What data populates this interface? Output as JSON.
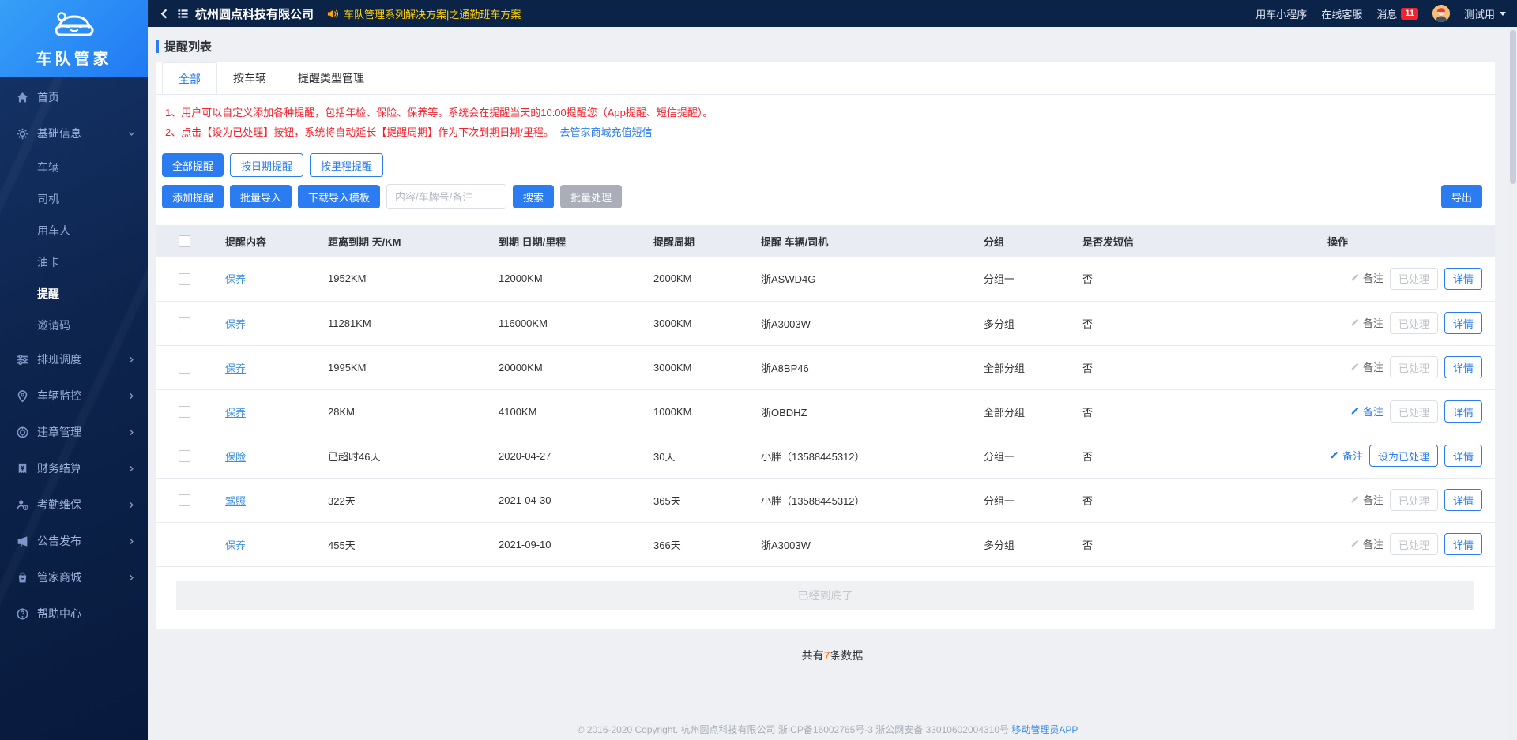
{
  "sidebar": {
    "logo_text": "车队管家",
    "home": {
      "label": "首页"
    },
    "group_basic": {
      "label": "基础信息"
    },
    "submenu": [
      {
        "label": "车辆"
      },
      {
        "label": "司机"
      },
      {
        "label": "用车人"
      },
      {
        "label": "油卡"
      },
      {
        "label": "提醒"
      },
      {
        "label": "邀请码"
      }
    ],
    "groups": [
      {
        "label": "排班调度"
      },
      {
        "label": "车辆监控"
      },
      {
        "label": "违章管理"
      },
      {
        "label": "财务结算"
      },
      {
        "label": "考勤维保"
      },
      {
        "label": "公告发布"
      },
      {
        "label": "管家商城"
      }
    ],
    "help": {
      "label": "帮助中心"
    }
  },
  "topbar": {
    "company": "杭州圆点科技有限公司",
    "announcement": "车队管理系列解决方案|之通勤班车方案",
    "mini_program": "用车小程序",
    "online_service": "在线客服",
    "messages_label": "消息",
    "messages_count": "11",
    "username": "测试用"
  },
  "page": {
    "title": "提醒列表",
    "tabs": [
      {
        "label": "全部"
      },
      {
        "label": "按车辆"
      },
      {
        "label": "提醒类型管理"
      }
    ],
    "notices": [
      "1、用户可以自定义添加各种提醒，包括年检、保险、保养等。系统会在提醒当天的10:00提醒您（App提醒、短信提醒）。",
      "2、点击【设为已处理】按钮，系统将自动延长【提醒周期】作为下次到期日期/里程。"
    ],
    "notice_link": "去管家商城充值短信",
    "filters": [
      {
        "label": "全部提醒"
      },
      {
        "label": "按日期提醒"
      },
      {
        "label": "按里程提醒"
      }
    ],
    "toolbar": {
      "add": "添加提醒",
      "import": "批量导入",
      "template": "下载导入模板",
      "search_placeholder": "内容/车牌号/备注",
      "search": "搜索",
      "batch": "批量处理",
      "export": "导出"
    }
  },
  "table": {
    "headers": [
      "提醒内容",
      "距离到期 天/KM",
      "到期 日期/里程",
      "提醒周期",
      "提醒 车辆/司机",
      "分组",
      "是否发短信",
      "操作"
    ],
    "note_label": "备注",
    "detail_label": "详情",
    "rows": [
      {
        "content": "保养",
        "distance": "1952KM",
        "due": "12000KM",
        "cycle": "2000KM",
        "target": "浙ASWD4G",
        "group": "分组一",
        "sms": "否",
        "note_active": false,
        "process_label": "已处理",
        "process_enabled": false
      },
      {
        "content": "保养",
        "distance": "11281KM",
        "due": "116000KM",
        "cycle": "3000KM",
        "target": "浙A3003W",
        "group": "多分组",
        "sms": "否",
        "note_active": false,
        "process_label": "已处理",
        "process_enabled": false
      },
      {
        "content": "保养",
        "distance": "1995KM",
        "due": "20000KM",
        "cycle": "3000KM",
        "target": "浙A8BP46",
        "group": "全部分组",
        "sms": "否",
        "note_active": false,
        "process_label": "已处理",
        "process_enabled": false
      },
      {
        "content": "保养",
        "distance": "28KM",
        "due": "4100KM",
        "cycle": "1000KM",
        "target": "浙OBDHZ",
        "group": "全部分组",
        "sms": "否",
        "note_active": true,
        "process_label": "已处理",
        "process_enabled": false
      },
      {
        "content": "保险",
        "distance": "已超时46天",
        "due": "2020-04-27",
        "cycle": "30天",
        "target": "小胖（13588445312）",
        "group": "分组一",
        "sms": "否",
        "note_active": true,
        "process_label": "设为已处理",
        "process_enabled": true
      },
      {
        "content": "驾照",
        "distance": "322天",
        "due": "2021-04-30",
        "cycle": "365天",
        "target": "小胖（13588445312）",
        "group": "分组一",
        "sms": "否",
        "note_active": false,
        "process_label": "已处理",
        "process_enabled": false
      },
      {
        "content": "保养",
        "distance": "455天",
        "due": "2021-09-10",
        "cycle": "366天",
        "target": "浙A3003W",
        "group": "多分组",
        "sms": "否",
        "note_active": false,
        "process_label": "已处理",
        "process_enabled": false
      }
    ],
    "end_text": "已经到底了",
    "count_prefix": "共有",
    "count_number": "7",
    "count_suffix": "条数据"
  },
  "footer": {
    "text": "© 2016-2020 Copyright. 杭州圆点科技有限公司 浙ICP备16002765号-3 浙公网安备 33010602004310号",
    "link": "移动管理员APP"
  }
}
